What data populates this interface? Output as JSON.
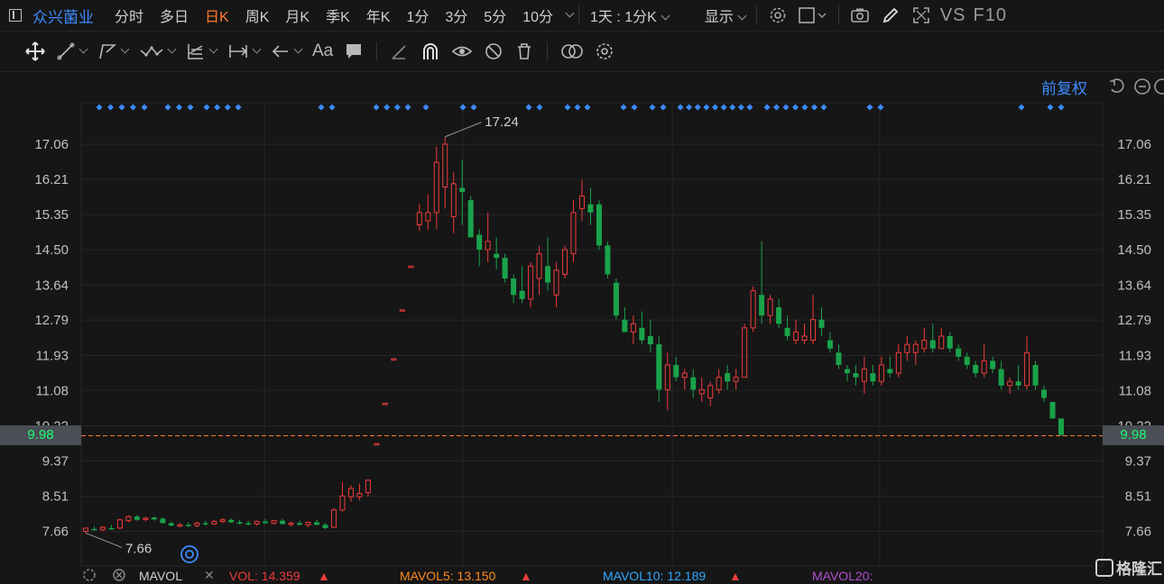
{
  "header": {
    "stock_name": "众兴菌业",
    "tabs": [
      {
        "label": "分时",
        "active": false
      },
      {
        "label": "多日",
        "active": false
      },
      {
        "label": "日K",
        "active": true
      },
      {
        "label": "周K",
        "active": false
      },
      {
        "label": "月K",
        "active": false
      },
      {
        "label": "季K",
        "active": false
      },
      {
        "label": "年K",
        "active": false
      },
      {
        "label": "1分",
        "active": false
      },
      {
        "label": "3分",
        "active": false
      },
      {
        "label": "5分",
        "active": false
      },
      {
        "label": "10分",
        "active": false
      }
    ],
    "period_selector": "1天 : 1分K",
    "display_label": "显示",
    "vs_label": "VS",
    "f10_label": "F10"
  },
  "toolbar": {
    "font_tool_label": "Aa",
    "icons": [
      "move-icon",
      "line-tool-icon",
      "polyline-icon",
      "wave-icon",
      "fib-icon",
      "measure-icon",
      "arrow-left-icon",
      "text-icon",
      "comment-icon",
      "pencil-icon",
      "magnet-icon",
      "eye-icon",
      "hide-icon",
      "trash-icon",
      "compare-icon",
      "settings-icon"
    ]
  },
  "chart_options": {
    "adjust_label": "前复权",
    "accent_color": "#3d8bff",
    "up_color": "#ee3b3b",
    "down_color": "#1aa34a",
    "current_price_color": "#ff7a2e"
  },
  "chart_data": {
    "type": "candlestick",
    "y_ticks": [
      "17.06",
      "16.21",
      "15.35",
      "14.50",
      "13.64",
      "12.79",
      "11.93",
      "11.08",
      "10.22",
      "9.37",
      "8.51",
      "7.66"
    ],
    "ylim": [
      7.0,
      18.0
    ],
    "current_price": "9.98",
    "high_label": "17.24",
    "low_label": "7.66",
    "candles": [
      [
        7.66,
        7.74,
        7.62,
        7.74
      ],
      [
        7.72,
        7.78,
        7.68,
        7.69
      ],
      [
        7.7,
        7.78,
        7.66,
        7.76
      ],
      [
        7.74,
        7.82,
        7.7,
        7.72
      ],
      [
        7.74,
        7.97,
        7.72,
        7.94
      ],
      [
        7.92,
        8.05,
        7.88,
        8.02
      ],
      [
        8.02,
        8.06,
        7.92,
        7.94
      ],
      [
        7.95,
        8.02,
        7.9,
        7.98
      ],
      [
        8.0,
        8.02,
        7.92,
        7.95
      ],
      [
        7.97,
        7.99,
        7.85,
        7.86
      ],
      [
        7.86,
        7.9,
        7.78,
        7.8
      ],
      [
        7.8,
        7.86,
        7.76,
        7.82
      ],
      [
        7.82,
        7.88,
        7.76,
        7.8
      ],
      [
        7.8,
        7.9,
        7.76,
        7.86
      ],
      [
        7.86,
        7.92,
        7.8,
        7.84
      ],
      [
        7.84,
        7.94,
        7.82,
        7.9
      ],
      [
        7.9,
        7.98,
        7.86,
        7.94
      ],
      [
        7.94,
        7.98,
        7.86,
        7.88
      ],
      [
        7.88,
        7.94,
        7.82,
        7.86
      ],
      [
        7.86,
        7.92,
        7.8,
        7.84
      ],
      [
        7.84,
        7.92,
        7.8,
        7.9
      ],
      [
        7.9,
        7.96,
        7.84,
        7.86
      ],
      [
        7.86,
        7.94,
        7.82,
        7.92
      ],
      [
        7.92,
        7.96,
        7.82,
        7.84
      ],
      [
        7.84,
        7.9,
        7.78,
        7.86
      ],
      [
        7.86,
        7.92,
        7.8,
        7.82
      ],
      [
        7.82,
        7.9,
        7.76,
        7.88
      ],
      [
        7.88,
        7.94,
        7.8,
        7.82
      ],
      [
        7.82,
        7.86,
        7.72,
        7.74
      ],
      [
        7.76,
        8.22,
        7.74,
        8.18
      ],
      [
        8.18,
        8.86,
        8.14,
        8.52
      ],
      [
        8.5,
        8.78,
        8.38,
        8.7
      ],
      [
        8.5,
        8.82,
        8.42,
        8.58
      ],
      [
        8.6,
        8.92,
        8.5,
        8.9
      ],
      [
        9.79,
        9.79,
        9.79,
        9.79
      ],
      [
        10.77,
        10.77,
        10.77,
        10.77
      ],
      [
        11.85,
        11.85,
        11.85,
        11.85
      ],
      [
        13.04,
        13.04,
        13.04,
        13.04
      ],
      [
        14.1,
        14.1,
        14.1,
        14.1
      ],
      [
        15.1,
        15.6,
        14.96,
        15.4
      ],
      [
        15.2,
        15.84,
        14.98,
        15.4
      ],
      [
        15.4,
        17.0,
        15.0,
        16.62
      ],
      [
        16.02,
        17.24,
        15.5,
        17.06
      ],
      [
        15.3,
        16.38,
        14.9,
        16.1
      ],
      [
        16.0,
        16.68,
        15.1,
        15.9
      ],
      [
        15.7,
        15.8,
        14.8,
        14.8
      ],
      [
        14.86,
        15.0,
        14.1,
        14.5
      ],
      [
        14.5,
        15.4,
        14.2,
        14.7
      ],
      [
        14.4,
        14.8,
        14.02,
        14.3
      ],
      [
        14.3,
        14.4,
        13.7,
        13.8
      ],
      [
        13.8,
        13.9,
        13.2,
        13.4
      ],
      [
        13.5,
        14.1,
        13.2,
        13.3
      ],
      [
        13.3,
        14.2,
        13.1,
        14.1
      ],
      [
        13.8,
        14.6,
        13.4,
        14.4
      ],
      [
        14.1,
        14.8,
        13.5,
        13.7
      ],
      [
        13.4,
        14.2,
        13.1,
        14.0
      ],
      [
        13.9,
        14.6,
        13.8,
        14.5
      ],
      [
        14.4,
        15.7,
        14.2,
        15.4
      ],
      [
        15.5,
        16.2,
        15.2,
        15.8
      ],
      [
        15.6,
        16.0,
        15.1,
        15.4
      ],
      [
        15.6,
        15.7,
        14.5,
        14.6
      ],
      [
        14.6,
        14.7,
        13.8,
        13.9
      ],
      [
        13.7,
        13.8,
        12.8,
        12.9
      ],
      [
        12.8,
        13.1,
        12.5,
        12.5
      ],
      [
        12.5,
        12.9,
        12.2,
        12.7
      ],
      [
        12.6,
        13.0,
        12.2,
        12.3
      ],
      [
        12.4,
        12.8,
        12.0,
        12.2
      ],
      [
        12.2,
        12.4,
        10.8,
        11.1
      ],
      [
        11.1,
        12.0,
        10.6,
        11.7
      ],
      [
        11.7,
        11.9,
        11.3,
        11.4
      ],
      [
        11.4,
        11.6,
        11.1,
        11.5
      ],
      [
        11.4,
        11.6,
        10.9,
        11.1
      ],
      [
        11.0,
        11.4,
        10.8,
        11.1
      ],
      [
        10.9,
        11.3,
        10.7,
        11.2
      ],
      [
        11.1,
        11.6,
        11.0,
        11.4
      ],
      [
        11.5,
        11.7,
        11.1,
        11.3
      ],
      [
        11.3,
        11.6,
        11.1,
        11.4
      ],
      [
        11.4,
        12.7,
        11.4,
        12.6
      ],
      [
        12.6,
        13.6,
        12.5,
        13.5
      ],
      [
        13.4,
        14.7,
        12.7,
        12.9
      ],
      [
        12.9,
        13.4,
        12.7,
        13.3
      ],
      [
        13.1,
        13.3,
        12.6,
        12.7
      ],
      [
        12.6,
        12.9,
        12.3,
        12.4
      ],
      [
        12.3,
        12.8,
        12.2,
        12.5
      ],
      [
        12.3,
        12.7,
        12.2,
        12.4
      ],
      [
        12.3,
        13.4,
        12.2,
        12.8
      ],
      [
        12.8,
        13.1,
        12.4,
        12.6
      ],
      [
        12.3,
        12.5,
        12.0,
        12.1
      ],
      [
        12.0,
        12.2,
        11.6,
        11.7
      ],
      [
        11.6,
        11.7,
        11.3,
        11.5
      ],
      [
        11.5,
        11.7,
        11.2,
        11.4
      ],
      [
        11.3,
        11.9,
        11.0,
        11.6
      ],
      [
        11.5,
        11.7,
        11.2,
        11.3
      ],
      [
        11.3,
        11.9,
        11.2,
        11.7
      ],
      [
        11.6,
        11.9,
        11.4,
        11.5
      ],
      [
        11.5,
        12.2,
        11.4,
        12.0
      ],
      [
        12.0,
        12.4,
        11.8,
        12.2
      ],
      [
        12.0,
        12.3,
        11.7,
        12.2
      ],
      [
        12.1,
        12.6,
        12.0,
        12.3
      ],
      [
        12.3,
        12.7,
        12.0,
        12.1
      ],
      [
        12.1,
        12.6,
        12.1,
        12.4
      ],
      [
        12.4,
        12.5,
        12.0,
        12.1
      ],
      [
        12.1,
        12.2,
        11.8,
        11.9
      ],
      [
        11.9,
        12.0,
        11.6,
        11.7
      ],
      [
        11.7,
        11.8,
        11.4,
        11.5
      ],
      [
        11.5,
        12.2,
        11.4,
        11.8
      ],
      [
        11.8,
        11.9,
        11.5,
        11.6
      ],
      [
        11.6,
        11.8,
        11.1,
        11.2
      ],
      [
        11.2,
        11.4,
        11.0,
        11.3
      ],
      [
        11.3,
        11.7,
        11.1,
        11.2
      ],
      [
        11.2,
        12.4,
        11.1,
        12.0
      ],
      [
        11.7,
        11.8,
        11.1,
        11.2
      ],
      [
        11.1,
        11.2,
        10.8,
        10.9
      ],
      [
        10.8,
        10.8,
        10.4,
        10.4
      ],
      [
        10.4,
        10.4,
        9.98,
        10.0
      ]
    ],
    "event_marker_groups": [
      [
        110,
        160,
        5
      ],
      [
        186,
        211,
        3
      ],
      [
        229,
        264,
        4
      ],
      [
        356,
        368,
        2
      ],
      [
        417,
        452,
        4
      ],
      [
        472,
        472,
        1
      ],
      [
        513,
        525,
        2
      ],
      [
        586,
        598,
        2
      ],
      [
        629,
        651,
        3
      ],
      [
        691,
        703,
        2
      ],
      [
        723,
        735,
        2
      ],
      [
        754,
        831,
        9
      ],
      [
        850,
        913,
        7
      ],
      [
        964,
        976,
        2
      ],
      [
        1132,
        1132,
        1
      ],
      [
        1164,
        1176,
        2
      ]
    ]
  },
  "volume": {
    "indicator_label": "MAVOL",
    "vol_label": "VOL: 14.359",
    "mavol5_label": "MAVOL5: 13.150",
    "mavol10_label": "MAVOL10: 12.189",
    "mavol20_label": "MAVOL20:",
    "vol_color": "#ee3b3b",
    "mavol5_color": "#ff8a1f",
    "mavol10_color": "#2fa8ff",
    "mavol20_color": "#b04fd0"
  },
  "watermark": "格隆汇"
}
